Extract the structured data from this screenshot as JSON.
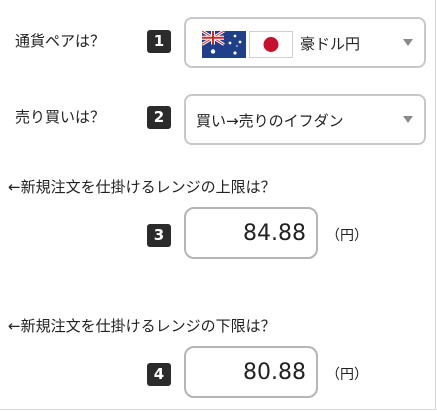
{
  "q1": {
    "label": "通貨ペアは？",
    "badge": "1",
    "selected": "豪ドル円",
    "flags": [
      "australia-flag",
      "japan-flag"
    ]
  },
  "q2": {
    "label": "売り買いは？",
    "badge": "2",
    "selected": "買い→売りのイフダン"
  },
  "q3": {
    "label": "←新規注文を仕掛けるレンジの上限は？",
    "badge": "3",
    "value": "84.88",
    "unit": "（円）"
  },
  "q4": {
    "label": "←新規注文を仕掛けるレンジの下限は？",
    "badge": "4",
    "value": "80.88",
    "unit": "（円）"
  },
  "colors": {
    "badge_bg": "#2b2b2b",
    "field_border": "#c8c8c8",
    "caret": "#8a8a8a"
  }
}
